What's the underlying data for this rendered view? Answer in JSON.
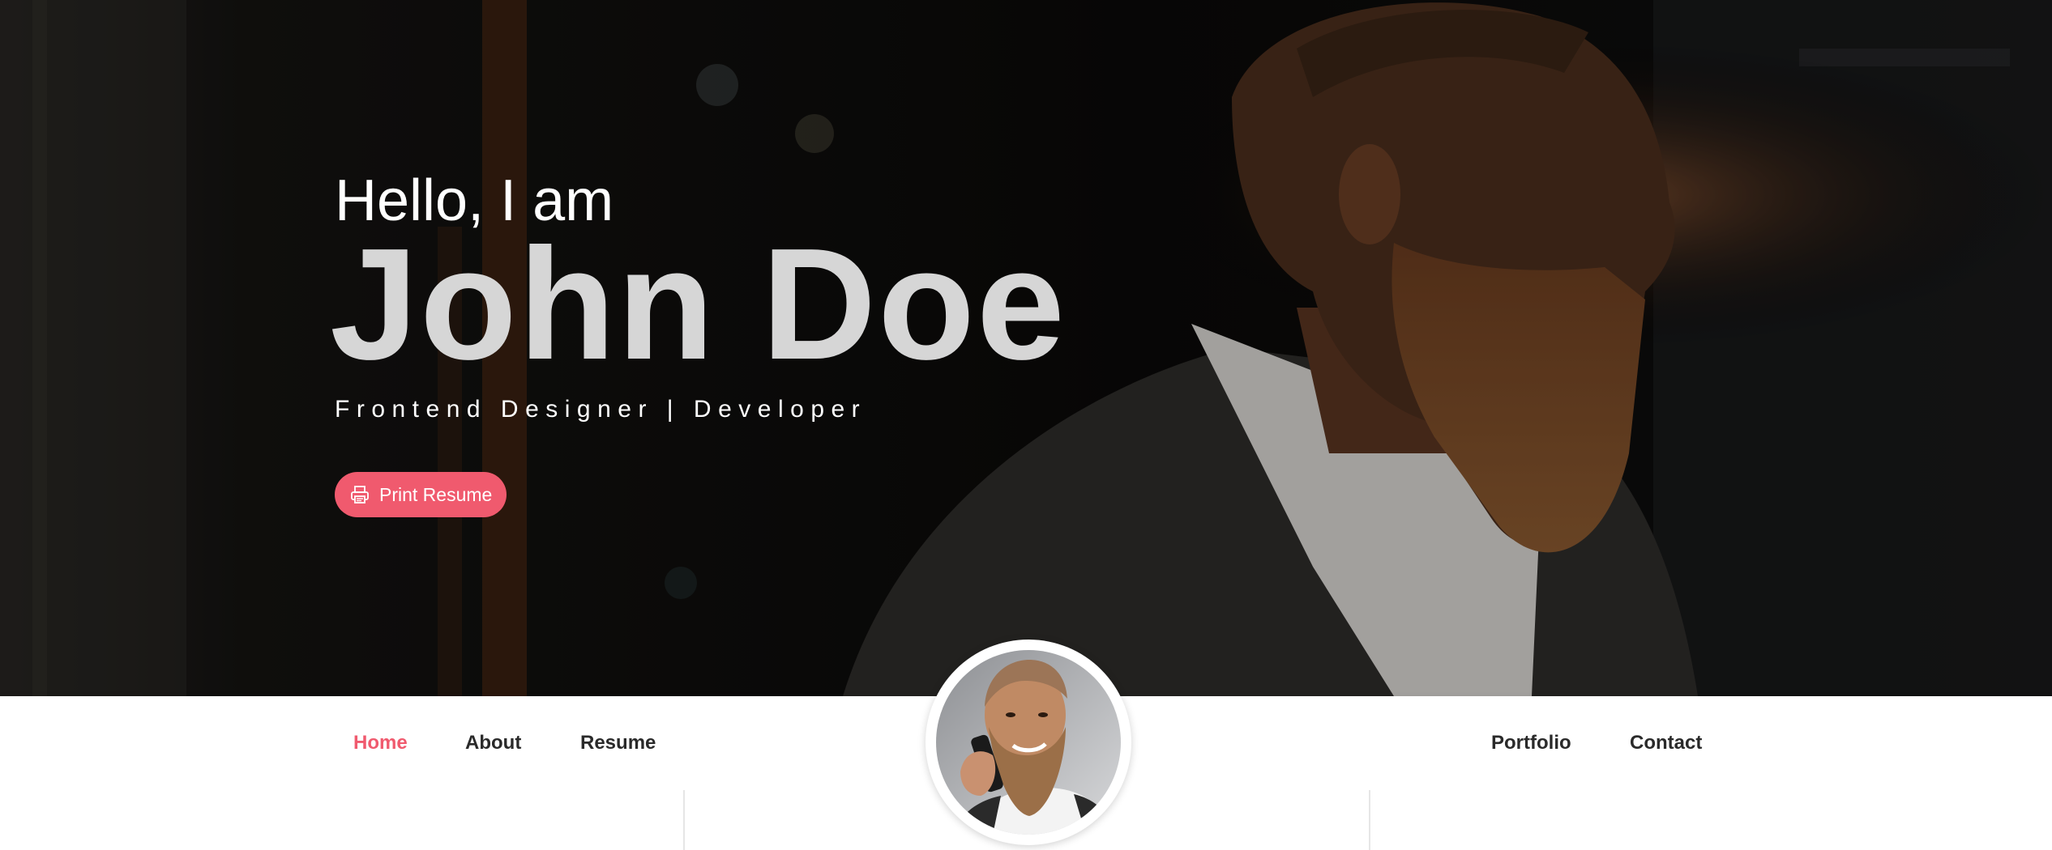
{
  "hero": {
    "greeting": "Hello, I am",
    "name": "John Doe",
    "tagline": "Frontend Designer | Developer",
    "print_button": "Print Resume"
  },
  "nav": {
    "left_items": [
      "Home",
      "About",
      "Resume"
    ],
    "right_items": [
      "Portfolio",
      "Contact"
    ],
    "active": "Home"
  },
  "icons": {
    "print_button": "printer-icon"
  },
  "colors": {
    "accent": "#f05a6e",
    "nav_text": "#2a2a2a",
    "name_text": "#d6d6d6",
    "hero_background": "#0c0b0a"
  }
}
